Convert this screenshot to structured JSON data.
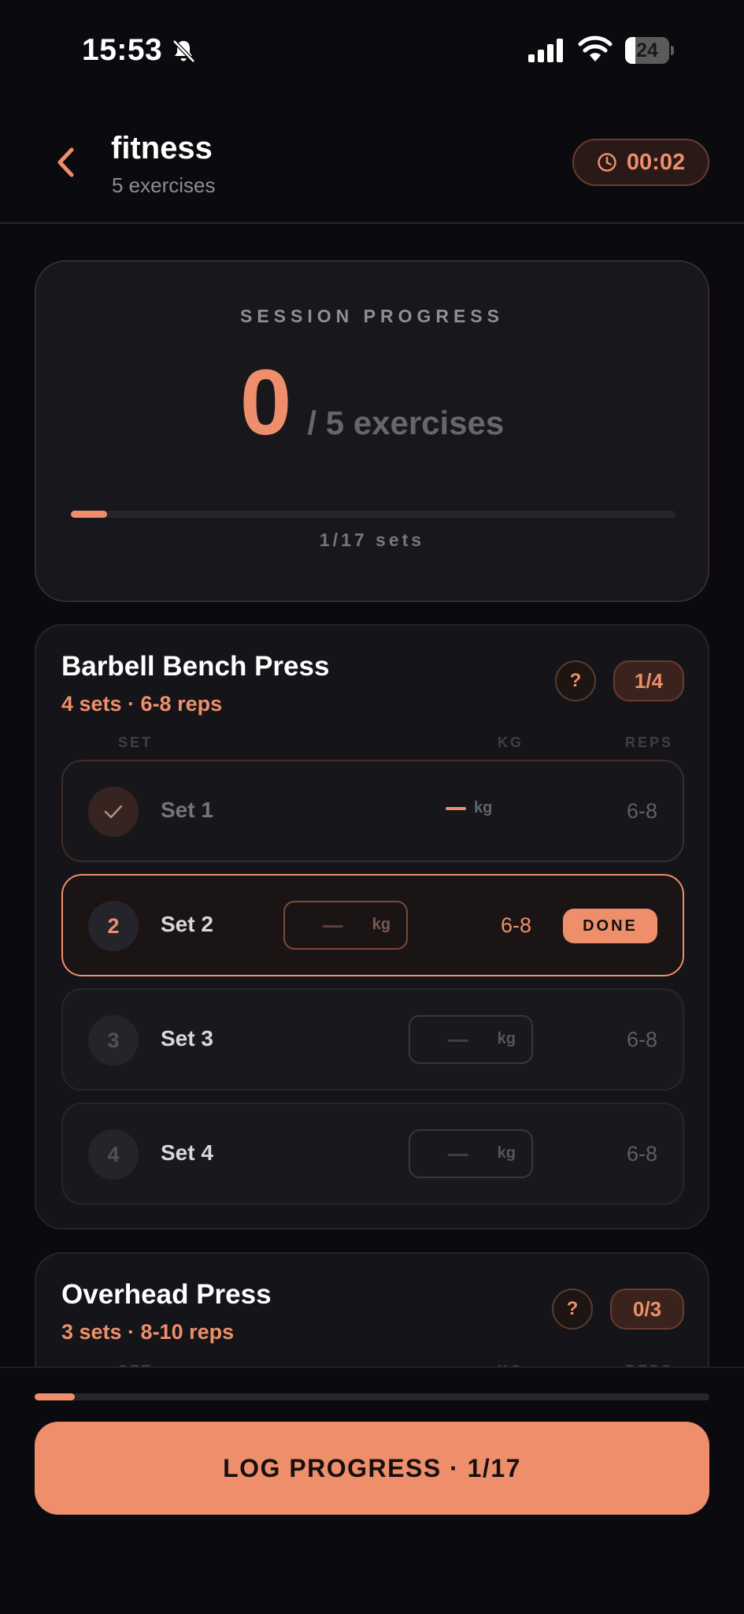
{
  "status_bar": {
    "time": "15:53",
    "battery": "24",
    "battery_level": 0.24
  },
  "header": {
    "title": "fitness",
    "subtitle": "5 exercises",
    "timer": "00:02"
  },
  "session": {
    "label": "SESSION PROGRESS",
    "completed": "0",
    "total_label": "/ 5 exercises",
    "sets_label": "1/17 sets",
    "progress": 0.06
  },
  "columns": {
    "set": "SET",
    "kg": "KG",
    "reps": "REPS"
  },
  "exercises": [
    {
      "name": "Barbell Bench Press",
      "meta": "4 sets · 6-8 reps",
      "help": "?",
      "count": "1/4",
      "sets": [
        {
          "number": "✓",
          "label": "Set 1",
          "kg_unit": "kg",
          "reps": "6-8",
          "state": "completed"
        },
        {
          "number": "2",
          "label": "Set 2",
          "kg_unit": "kg",
          "reps": "6-8",
          "state": "active",
          "done_label": "DONE"
        },
        {
          "number": "3",
          "label": "Set 3",
          "kg_unit": "kg",
          "reps": "6-8",
          "state": "pending"
        },
        {
          "number": "4",
          "label": "Set 4",
          "kg_unit": "kg",
          "reps": "6-8",
          "state": "pending"
        }
      ]
    },
    {
      "name": "Overhead Press",
      "meta": "3 sets · 8-10 reps",
      "help": "?",
      "count": "0/3"
    }
  ],
  "footer": {
    "button_label": "LOG PROGRESS · 1/17",
    "progress": 0.06
  },
  "colors": {
    "accent": "#ee8e6b",
    "background": "#0b0b0f",
    "card": "#141419"
  }
}
